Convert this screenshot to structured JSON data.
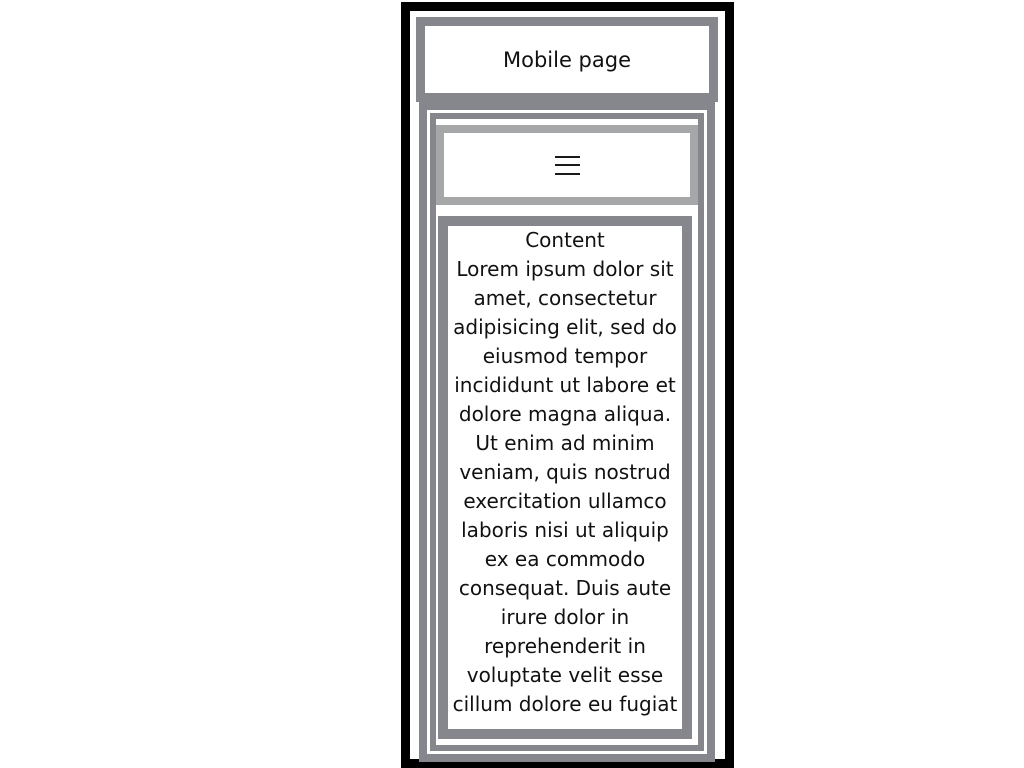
{
  "header": {
    "title": "Mobile page"
  },
  "nav": {
    "menu_icon": "hamburger-menu-icon"
  },
  "content": {
    "heading": "Content",
    "body": "Lorem ipsum dolor sit amet, consectetur adipisicing elit, sed do eiusmod tempor incididunt ut labore et dolore magna aliqua. Ut enim ad minim veniam, quis nostrud exercitation ullamco laboris nisi ut aliquip ex ea commodo consequat. Duis aute irure dolor in reprehenderit in voluptate velit esse cillum dolore eu fugiat"
  },
  "colors": {
    "frame": "#000000",
    "border_gray": "#85878d",
    "border_light_gray": "#a5a7a9"
  }
}
